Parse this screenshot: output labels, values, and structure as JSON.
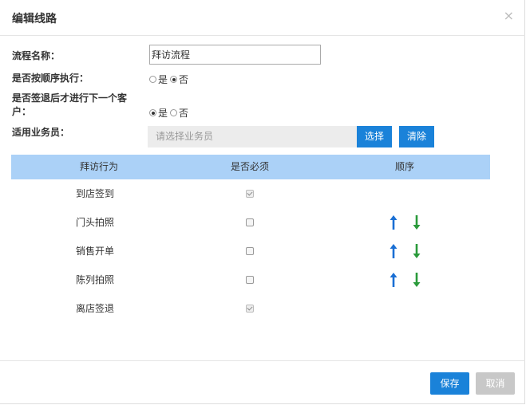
{
  "dialog": {
    "title": "编辑线路",
    "close_symbol": "×"
  },
  "form": {
    "name_label": "流程名称：",
    "name_value": "拜访流程",
    "order_label": "是否按顺序执行：",
    "order_yes": "是",
    "order_no": "否",
    "order_selected": "否",
    "signout_label_line1": "是否签退后才进行下一个客",
    "signout_label_line2": "户：",
    "signout_yes": "是",
    "signout_no": "否",
    "signout_selected": "是",
    "staff_label": "适用业务员：",
    "staff_placeholder": "请选择业务员",
    "select_button": "选择",
    "clear_button": "清除"
  },
  "table": {
    "headers": [
      "拜访行为",
      "是否必须",
      "顺序"
    ],
    "rows": [
      {
        "name": "到店签到",
        "required": true,
        "sortable": false
      },
      {
        "name": "门头拍照",
        "required": false,
        "sortable": true
      },
      {
        "name": "销售开单",
        "required": false,
        "sortable": true
      },
      {
        "name": "陈列拍照",
        "required": false,
        "sortable": true
      },
      {
        "name": "离店签退",
        "required": true,
        "sortable": false
      }
    ]
  },
  "footer": {
    "save_button": "保存",
    "cancel_button": "取消"
  },
  "colors": {
    "primary": "#1a82d9",
    "header_bg": "#abd1f7",
    "up_arrow": "#1a6fd4",
    "down_arrow": "#2a9a3a",
    "disabled": "#c8c8c8"
  }
}
